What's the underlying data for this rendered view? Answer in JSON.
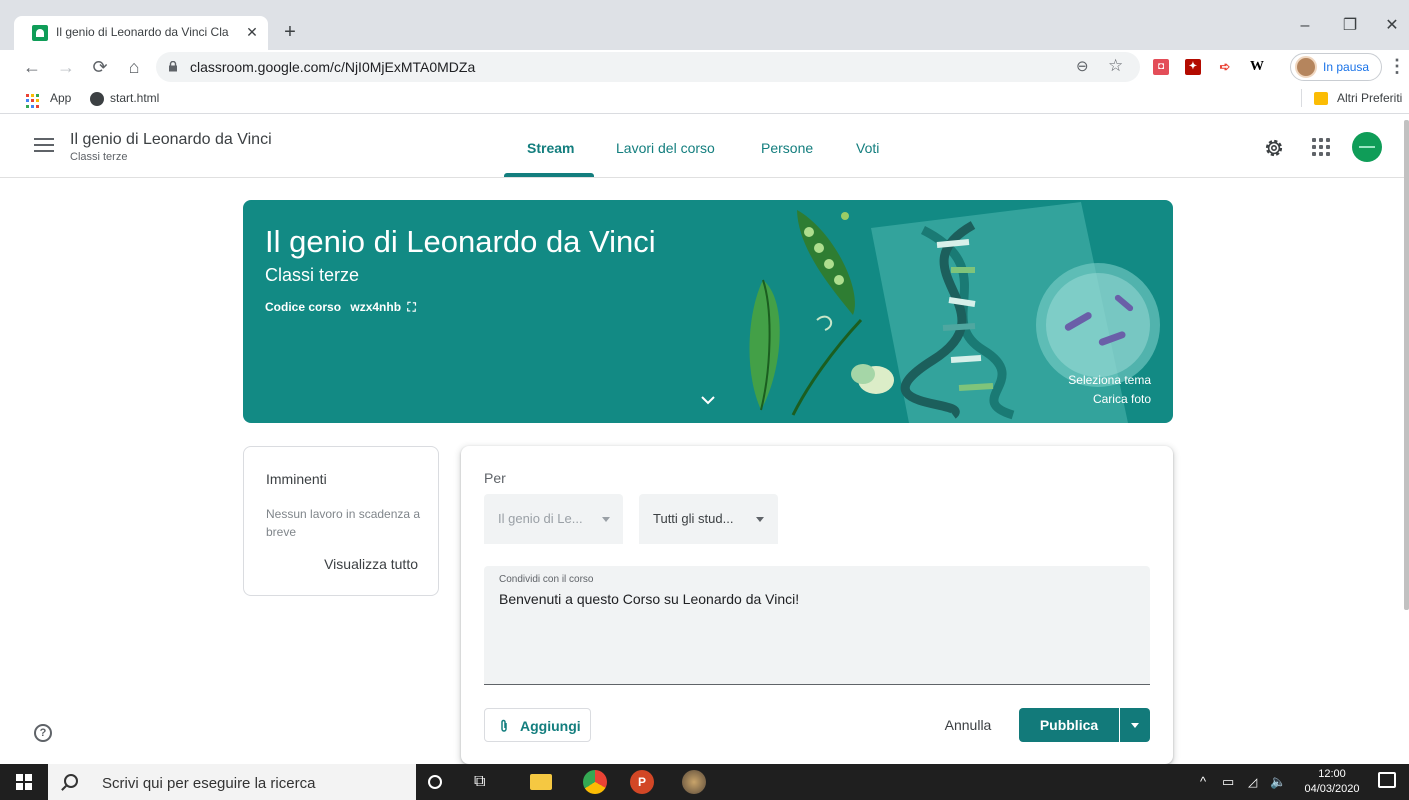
{
  "browser": {
    "tab_title": "Il genio di Leonardo da Vinci Cla",
    "tab_close": "✕",
    "new_tab": "+",
    "url": "classroom.google.com/c/NjI0MjExMTA0MDZa",
    "profile_label": "In pausa",
    "window_minimize": "–",
    "window_restore": "❐",
    "window_close": "✕",
    "bookmarks": [
      {
        "label": "App"
      },
      {
        "label": "start.html"
      }
    ],
    "other_bookmarks": "Altri Preferiti",
    "extensions": [
      "ext-pocket",
      "ext-acrobat",
      "ext-arrow",
      "W"
    ]
  },
  "classroom": {
    "header": {
      "class_name": "Il genio di Leonardo da Vinci",
      "section": "Classi terze",
      "tabs": [
        {
          "label": "Stream",
          "active": true
        },
        {
          "label": "Lavori del corso",
          "active": false
        },
        {
          "label": "Persone",
          "active": false
        },
        {
          "label": "Voti",
          "active": false
        }
      ]
    },
    "banner": {
      "title": "Il genio di Leonardo da Vinci",
      "subtitle": "Classi terze",
      "code_label": "Codice corso",
      "code_value": "wzx4nhb",
      "select_theme": "Seleziona tema",
      "upload_photo": "Carica foto",
      "color": "#128a84"
    },
    "upcoming": {
      "heading": "Imminenti",
      "empty": "Nessun lavoro in scadenza a breve",
      "view_all": "Visualizza tutto"
    },
    "composer": {
      "for_label": "Per",
      "class_select": "Il genio di Le...",
      "students_select": "Tutti gli stud...",
      "post_label": "Condividi con il corso",
      "post_text": "Benvenuti a questo Corso su Leonardo da Vinci!",
      "add_label": "Aggiungi",
      "cancel_label": "Annulla",
      "publish_label": "Pubblica"
    },
    "help": "?",
    "accent_color": "#137e7e"
  },
  "taskbar": {
    "search_placeholder": "Scrivi qui per eseguire la ricerca",
    "time": "12:00",
    "date": "04/03/2020"
  }
}
